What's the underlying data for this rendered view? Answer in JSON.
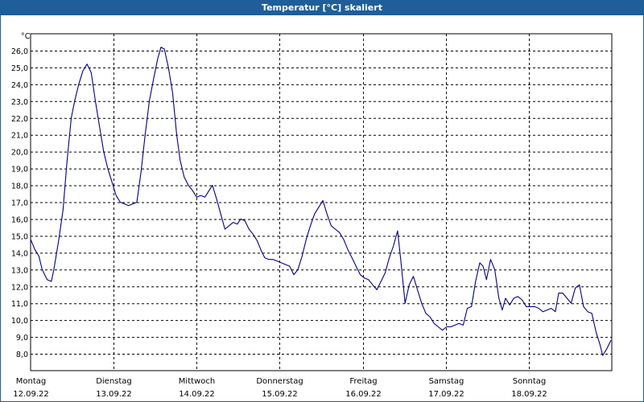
{
  "window": {
    "title": "Temperatur [°C] skaliert"
  },
  "chart_data": {
    "type": "line",
    "title": "Temperatur [°C] skaliert",
    "ylabel": "°C",
    "ylim": [
      7.0,
      27.0
    ],
    "yticks": [
      "8,0",
      "9,0",
      "10,0",
      "11,0",
      "12,0",
      "13,0",
      "14,0",
      "15,0",
      "16,0",
      "17,0",
      "18,0",
      "19,0",
      "20,0",
      "21,0",
      "22,0",
      "23,0",
      "24,0",
      "25,0",
      "26,0"
    ],
    "xlim": [
      0,
      7.0
    ],
    "day_labels": [
      {
        "day": "Montag",
        "date": "12.09.22"
      },
      {
        "day": "Dienstag",
        "date": "13.09.22"
      },
      {
        "day": "Mittwoch",
        "date": "14.09.22"
      },
      {
        "day": "Donnerstag",
        "date": "15.09.22"
      },
      {
        "day": "Freitag",
        "date": "16.09.22"
      },
      {
        "day": "Samstag",
        "date": "17.09.22"
      },
      {
        "day": "Sonntag",
        "date": "18.09.22"
      }
    ],
    "grid": true,
    "line_color": "#00008b",
    "series": [
      {
        "points": [
          [
            0.0,
            14.8
          ],
          [
            0.05,
            14.2
          ],
          [
            0.1,
            13.8
          ],
          [
            0.14,
            13.0
          ],
          [
            0.2,
            12.4
          ],
          [
            0.25,
            12.3
          ],
          [
            0.28,
            13.0
          ],
          [
            0.34,
            14.8
          ],
          [
            0.39,
            16.5
          ],
          [
            0.44,
            19.5
          ],
          [
            0.49,
            22.0
          ],
          [
            0.53,
            23.0
          ],
          [
            0.58,
            24.0
          ],
          [
            0.63,
            24.8
          ],
          [
            0.68,
            25.2
          ],
          [
            0.73,
            24.7
          ],
          [
            0.78,
            23.0
          ],
          [
            0.83,
            21.5
          ],
          [
            0.88,
            20.0
          ],
          [
            0.93,
            19.0
          ],
          [
            0.98,
            18.2
          ],
          [
            1.03,
            17.4
          ],
          [
            1.08,
            17.0
          ],
          [
            1.13,
            16.9
          ],
          [
            1.18,
            16.8
          ],
          [
            1.23,
            16.9
          ],
          [
            1.28,
            17.0
          ],
          [
            1.33,
            18.8
          ],
          [
            1.38,
            21.0
          ],
          [
            1.43,
            23.0
          ],
          [
            1.48,
            24.3
          ],
          [
            1.53,
            25.5
          ],
          [
            1.57,
            26.2
          ],
          [
            1.61,
            26.1
          ],
          [
            1.66,
            25.0
          ],
          [
            1.71,
            23.5
          ],
          [
            1.76,
            21.0
          ],
          [
            1.8,
            19.5
          ],
          [
            1.85,
            18.5
          ],
          [
            1.9,
            18.0
          ],
          [
            1.95,
            17.7
          ],
          [
            2.0,
            17.3
          ],
          [
            2.05,
            17.4
          ],
          [
            2.1,
            17.3
          ],
          [
            2.15,
            17.7
          ],
          [
            2.19,
            18.0
          ],
          [
            2.24,
            17.2
          ],
          [
            2.29,
            16.3
          ],
          [
            2.34,
            15.4
          ],
          [
            2.39,
            15.6
          ],
          [
            2.44,
            15.8
          ],
          [
            2.49,
            15.7
          ],
          [
            2.53,
            16.0
          ],
          [
            2.58,
            15.9
          ],
          [
            2.63,
            15.4
          ],
          [
            2.68,
            15.1
          ],
          [
            2.73,
            14.7
          ],
          [
            2.78,
            14.1
          ],
          [
            2.82,
            13.7
          ],
          [
            2.87,
            13.6
          ],
          [
            2.92,
            13.6
          ],
          [
            2.97,
            13.5
          ],
          [
            3.02,
            13.4
          ],
          [
            3.07,
            13.3
          ],
          [
            3.12,
            13.2
          ],
          [
            3.17,
            12.7
          ],
          [
            3.22,
            13.0
          ],
          [
            3.27,
            13.8
          ],
          [
            3.32,
            14.8
          ],
          [
            3.37,
            15.6
          ],
          [
            3.42,
            16.3
          ],
          [
            3.47,
            16.7
          ],
          [
            3.52,
            17.1
          ],
          [
            3.57,
            16.3
          ],
          [
            3.62,
            15.6
          ],
          [
            3.67,
            15.4
          ],
          [
            3.72,
            15.2
          ],
          [
            3.77,
            14.8
          ],
          [
            3.82,
            14.2
          ],
          [
            3.87,
            13.7
          ],
          [
            3.92,
            13.2
          ],
          [
            3.97,
            12.7
          ],
          [
            4.02,
            12.5
          ],
          [
            4.07,
            12.4
          ],
          [
            4.12,
            12.1
          ],
          [
            4.17,
            11.8
          ],
          [
            4.22,
            12.3
          ],
          [
            4.27,
            12.8
          ],
          [
            4.32,
            13.7
          ],
          [
            4.37,
            14.4
          ],
          [
            4.42,
            15.3
          ],
          [
            4.46,
            13.5
          ],
          [
            4.51,
            11.0
          ],
          [
            4.56,
            12.1
          ],
          [
            4.61,
            12.6
          ],
          [
            4.66,
            11.8
          ],
          [
            4.71,
            11.0
          ],
          [
            4.76,
            10.4
          ],
          [
            4.81,
            10.2
          ],
          [
            4.86,
            9.8
          ],
          [
            4.91,
            9.6
          ],
          [
            4.96,
            9.4
          ],
          [
            5.01,
            9.6
          ],
          [
            5.06,
            9.6
          ],
          [
            5.11,
            9.7
          ],
          [
            5.16,
            9.8
          ],
          [
            5.21,
            9.7
          ],
          [
            5.26,
            10.7
          ],
          [
            5.31,
            10.8
          ],
          [
            5.36,
            12.3
          ],
          [
            5.41,
            13.4
          ],
          [
            5.45,
            13.2
          ],
          [
            5.49,
            12.4
          ],
          [
            5.54,
            13.6
          ],
          [
            5.59,
            13.0
          ],
          [
            5.64,
            11.3
          ],
          [
            5.68,
            10.6
          ],
          [
            5.72,
            11.3
          ],
          [
            5.77,
            10.9
          ],
          [
            5.82,
            11.3
          ],
          [
            5.87,
            11.4
          ],
          [
            5.92,
            11.2
          ],
          [
            5.97,
            10.8
          ],
          [
            6.02,
            10.8
          ],
          [
            6.07,
            10.8
          ],
          [
            6.12,
            10.7
          ],
          [
            6.17,
            10.5
          ],
          [
            6.22,
            10.6
          ],
          [
            6.27,
            10.7
          ],
          [
            6.32,
            10.5
          ],
          [
            6.36,
            11.6
          ],
          [
            6.41,
            11.6
          ],
          [
            6.46,
            11.3
          ],
          [
            6.51,
            11.0
          ],
          [
            6.56,
            11.9
          ],
          [
            6.61,
            12.1
          ],
          [
            6.66,
            10.8
          ],
          [
            6.71,
            10.5
          ],
          [
            6.76,
            10.4
          ],
          [
            6.81,
            9.3
          ],
          [
            6.86,
            8.5
          ],
          [
            6.89,
            7.9
          ],
          [
            6.94,
            8.3
          ],
          [
            6.99,
            8.8
          ]
        ]
      }
    ]
  }
}
